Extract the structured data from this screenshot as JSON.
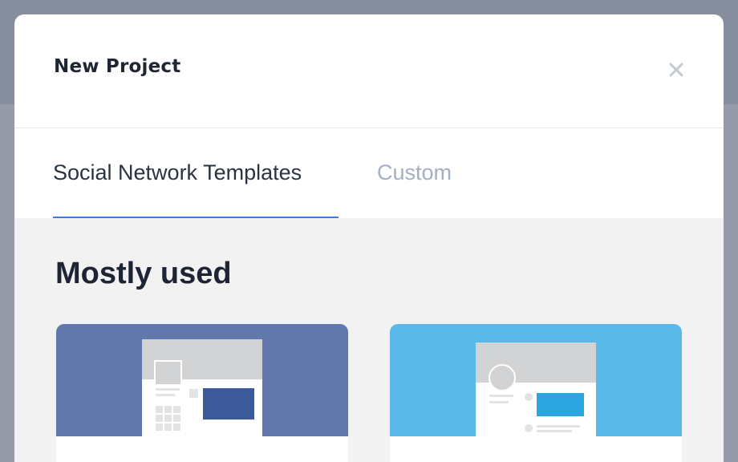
{
  "modal": {
    "title": "New Project",
    "close_icon": "close-icon"
  },
  "tabs": [
    {
      "label": "Social Network Templates",
      "active": true
    },
    {
      "label": "Custom",
      "active": false
    }
  ],
  "section": {
    "title": "Mostly used"
  },
  "templates": [
    {
      "icon": "facebook-template-preview",
      "color": "#6178ad"
    },
    {
      "icon": "twitter-template-preview",
      "color": "#5ab9e8"
    }
  ],
  "colors": {
    "accent": "#3b7de0",
    "facebook": "#6178ad",
    "twitter": "#5ab9e8"
  }
}
